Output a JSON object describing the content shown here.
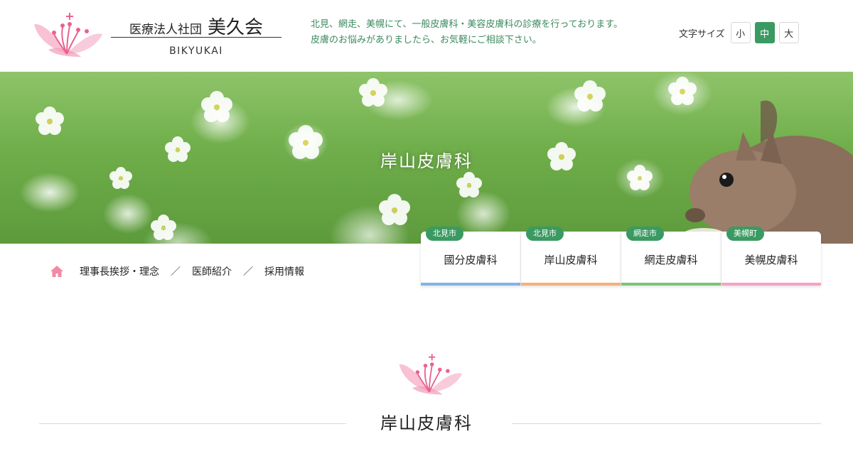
{
  "header": {
    "logo_org": "医療法人社団",
    "logo_name": "美久会",
    "logo_en": "BIKYUKAI",
    "tagline_line1": "北見、網走、美幌にて、一般皮膚科・美容皮膚科の診療を行っております。",
    "tagline_line2": "皮膚のお悩みがありましたら、お気軽にご相談下さい。",
    "fontsize_label": "文字サイズ",
    "fontsize_small": "小",
    "fontsize_medium": "中",
    "fontsize_large": "大"
  },
  "hero": {
    "title": "岸山皮膚科"
  },
  "clinics": [
    {
      "city": "北見市",
      "name": "國分皮膚科",
      "color": "#7fb5e8"
    },
    {
      "city": "北見市",
      "name": "岸山皮膚科",
      "color": "#f4b27a"
    },
    {
      "city": "網走市",
      "name": "網走皮膚科",
      "color": "#7cc47a"
    },
    {
      "city": "美幌町",
      "name": "美幌皮膚科",
      "color": "#f5a3c8"
    }
  ],
  "subnav": {
    "item1": "理事長挨拶・理念",
    "item2": "医師紹介",
    "item3": "採用情報",
    "separator": "／"
  },
  "section": {
    "title": "岸山皮膚科"
  },
  "colors": {
    "accent_green": "#3a9a62",
    "tagline_green": "#3a8a5e",
    "logo_pink": "#f29bb8"
  }
}
